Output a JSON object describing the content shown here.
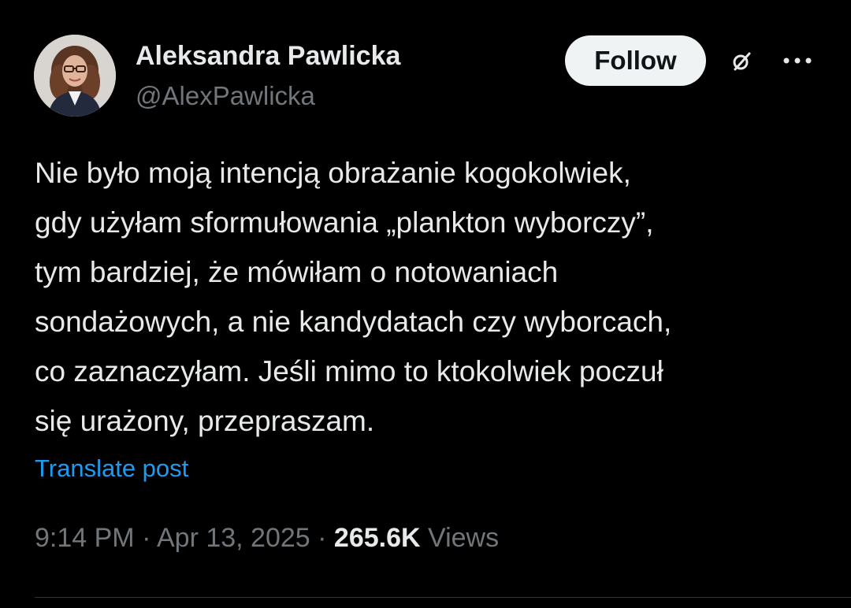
{
  "author": {
    "name": "Aleksandra Pawlicka",
    "handle": "@AlexPawlicka"
  },
  "actions": {
    "follow_label": "Follow",
    "grok_icon": "grok-icon",
    "more_icon": "more-horizontal-icon"
  },
  "post": {
    "text": "Nie było moją intencją obrażanie kogokolwiek,\ngdy użyłam sformułowania „plankton wyborczy”,\ntym bardziej, że mówiłam o notowaniach\nsondażowych, a nie kandydatach czy wyborcach,\nco zaznaczyłam. Jeśli mimo to ktokolwiek poczuł\nsię urażony, przepraszam.",
    "translate_label": "Translate post"
  },
  "meta": {
    "time": "9:14 PM",
    "separator": "·",
    "date": "Apr 13, 2025",
    "views_count": "265.6K",
    "views_label": "Views"
  },
  "colors": {
    "background": "#000000",
    "text_primary": "#e7e9ea",
    "text_secondary": "#71767b",
    "link": "#1d9bf0",
    "follow_bg": "#eff3f4"
  }
}
